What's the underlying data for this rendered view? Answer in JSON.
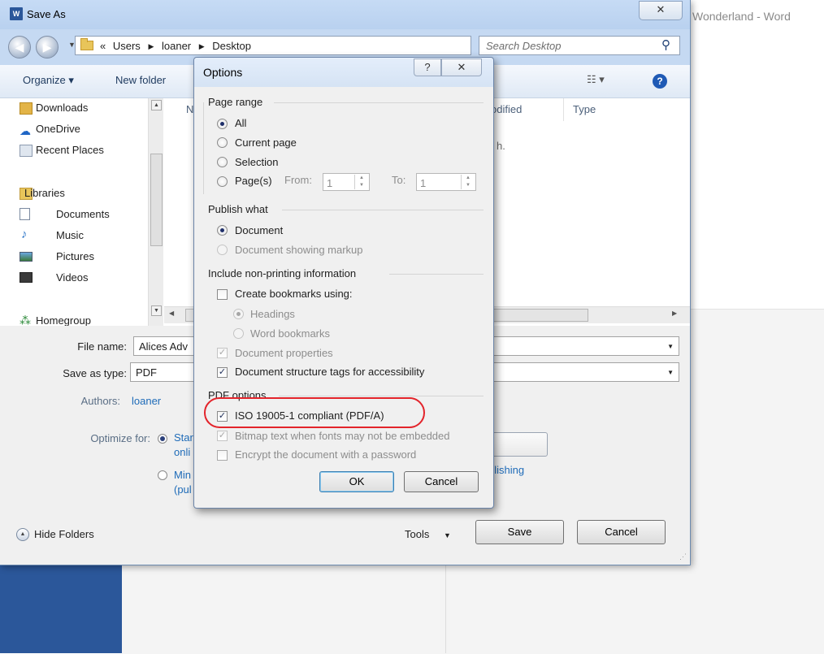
{
  "word": {
    "title_fragment": "Wonderland - Word"
  },
  "save_as": {
    "title": "Save As",
    "close_glyph": "✕",
    "address": {
      "prefix": "«",
      "crumbs": [
        "Users",
        "loaner",
        "Desktop"
      ]
    },
    "search_placeholder": "Search Desktop",
    "toolbar": {
      "organize": "Organize ▾",
      "new_folder": "New folder"
    },
    "nav_items": [
      {
        "label": "Downloads",
        "icon": "downloads-folder-icon"
      },
      {
        "label": "OneDrive",
        "icon": "onedrive-cloud-icon"
      },
      {
        "label": "Recent Places",
        "icon": "recent-places-icon"
      },
      {
        "label": "Libraries",
        "icon": "libraries-icon"
      },
      {
        "label": "Documents",
        "icon": "documents-icon"
      },
      {
        "label": "Music",
        "icon": "music-icon"
      },
      {
        "label": "Pictures",
        "icon": "pictures-icon"
      },
      {
        "label": "Videos",
        "icon": "videos-icon"
      },
      {
        "label": "Homegroup",
        "icon": "homegroup-icon"
      }
    ],
    "columns": {
      "name_fragment": "N",
      "date_fragment": "odified",
      "type": "Type"
    },
    "empty_fragment": "h.",
    "file_name_label": "File name:",
    "file_name_value": "Alices Adv",
    "save_as_type_label": "Save as type:",
    "save_as_type_value": "PDF",
    "authors_label": "Authors:",
    "authors_value": "loaner",
    "optimize_label": "Optimize for:",
    "optimize_standard_line1": "Star",
    "optimize_standard_line2": "onli",
    "optimize_min_line1": "Min",
    "optimize_min_line2": "(pul",
    "publishing_fragment": "blishing",
    "hide_folders": "Hide Folders",
    "tools": "Tools",
    "save": "Save",
    "cancel": "Cancel"
  },
  "options": {
    "title": "Options",
    "help_glyph": "?",
    "close_glyph": "✕",
    "page_range": {
      "label": "Page range",
      "all": "All",
      "current_page": "Current page",
      "selection": "Selection",
      "pages": "Page(s)",
      "from_label": "From:",
      "from_value": "1",
      "to_label": "To:",
      "to_value": "1"
    },
    "publish_what": {
      "label": "Publish what",
      "document": "Document",
      "document_markup": "Document showing markup"
    },
    "non_printing": {
      "label": "Include non-printing information",
      "create_bookmarks": "Create bookmarks using:",
      "headings": "Headings",
      "word_bookmarks": "Word bookmarks",
      "document_properties": "Document properties",
      "structure_tags": "Document structure tags for accessibility"
    },
    "pdf_options": {
      "label": "PDF options",
      "iso": "ISO 19005-1 compliant (PDF/A)",
      "bitmap": "Bitmap text when fonts may not be embedded",
      "encrypt": "Encrypt the document with a password"
    },
    "ok": "OK",
    "cancel": "Cancel"
  },
  "colors": {
    "word_blue": "#2b579a",
    "highlight_red": "#e3242b",
    "link_blue": "#1e6bb8"
  }
}
